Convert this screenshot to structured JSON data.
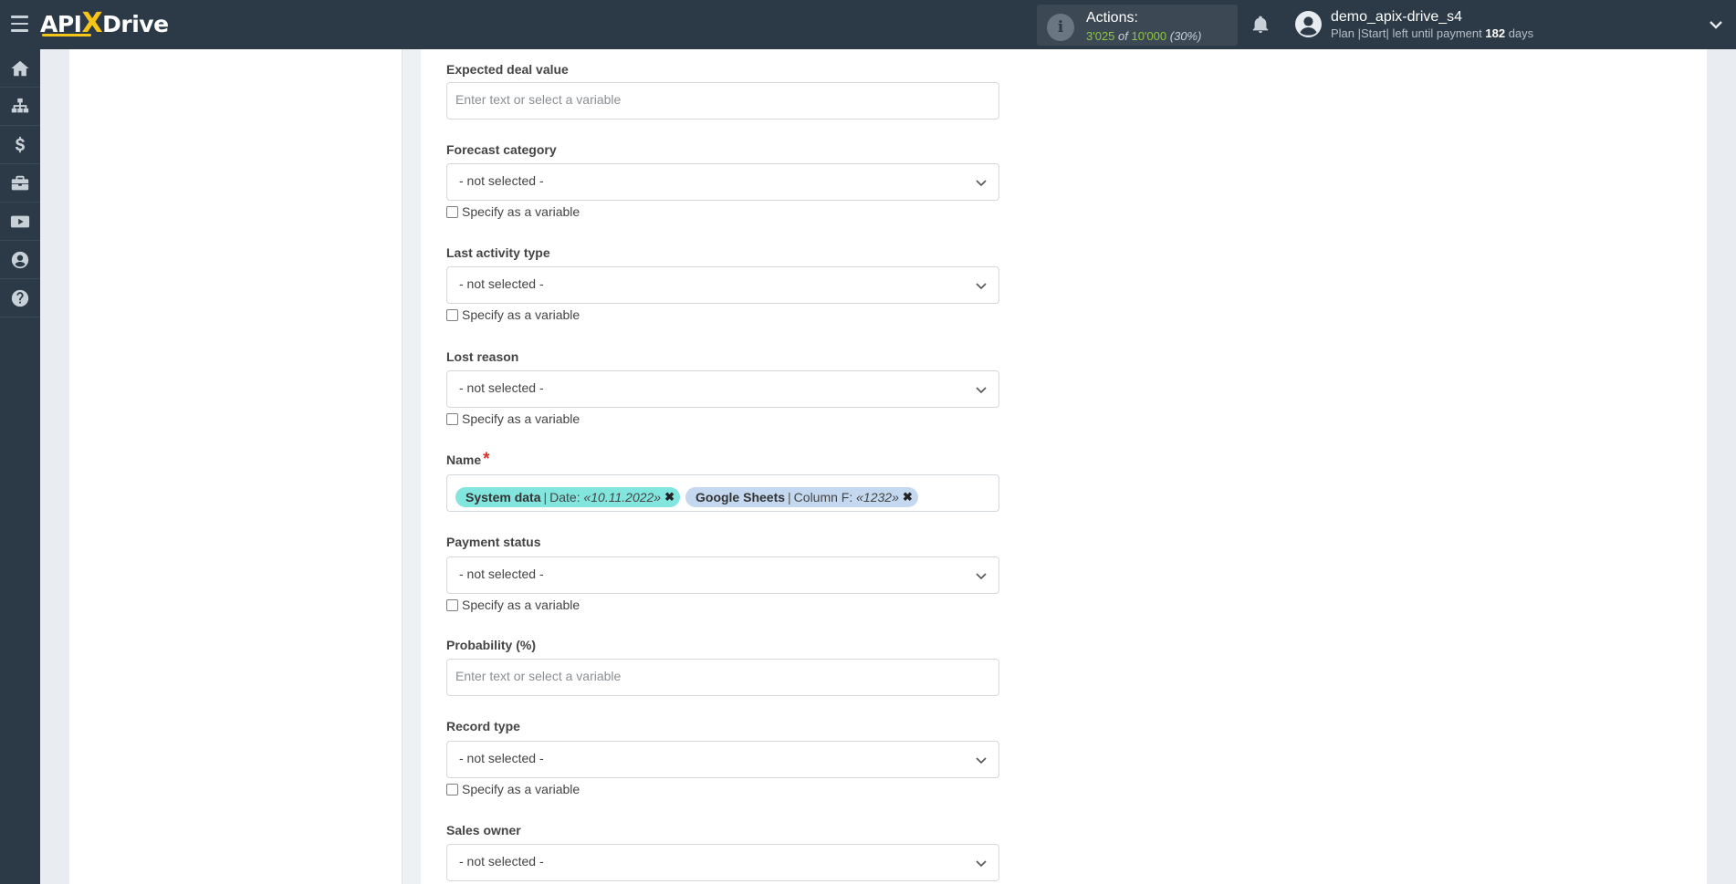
{
  "header": {
    "logo": {
      "api": "API",
      "x": "X",
      "drive": "Drive"
    },
    "actions_label": "Actions:",
    "actions_used": "3'025",
    "actions_of": "of",
    "actions_total": "10'000",
    "actions_pct": "(30%)",
    "username": "demo_apix-drive_s4",
    "plan_prefix": "Plan |Start| left until payment",
    "plan_days": "182",
    "plan_suffix": "days",
    "icons": [
      "menu-icon",
      "info-icon",
      "bell-icon",
      "user-avatar-icon",
      "chevron-down-icon"
    ]
  },
  "sidebar": {
    "items": [
      {
        "name": "home",
        "icon": "home-icon"
      },
      {
        "name": "connections",
        "icon": "sitemap-icon"
      },
      {
        "name": "billing",
        "icon": "dollar-icon"
      },
      {
        "name": "tools",
        "icon": "briefcase-icon"
      },
      {
        "name": "videos",
        "icon": "youtube-icon"
      },
      {
        "name": "account",
        "icon": "user-circle-icon"
      },
      {
        "name": "help",
        "icon": "question-circle-icon"
      }
    ]
  },
  "form": {
    "specify_label": "Specify as a variable",
    "input_placeholder": "Enter text or select a variable",
    "not_selected": "- not selected -",
    "fields": {
      "expected_deal_value": {
        "label": "Expected deal value"
      },
      "forecast_category": {
        "label": "Forecast category"
      },
      "last_activity_type": {
        "label": "Last activity type"
      },
      "lost_reason": {
        "label": "Lost reason"
      },
      "name": {
        "label": "Name",
        "required_mark": "*",
        "tags": [
          {
            "source": "System data",
            "sep": "|",
            "field": "Date:",
            "value": "«10.11.2022»",
            "remove": "✖"
          },
          {
            "source": "Google Sheets",
            "sep": "|",
            "field": "Column F:",
            "value": "«1232»",
            "remove": "✖"
          }
        ]
      },
      "payment_status": {
        "label": "Payment status"
      },
      "probability": {
        "label": "Probability (%)"
      },
      "record_type": {
        "label": "Record type"
      },
      "sales_owner": {
        "label": "Sales owner"
      }
    }
  },
  "colors": {
    "topbar": "#2c3a47",
    "accent_green": "#8dc63f",
    "logo_accent": "#f5c518",
    "tag_system": "#82e6de",
    "tag_sheets": "#c4d8ef",
    "required": "#d9342b"
  }
}
